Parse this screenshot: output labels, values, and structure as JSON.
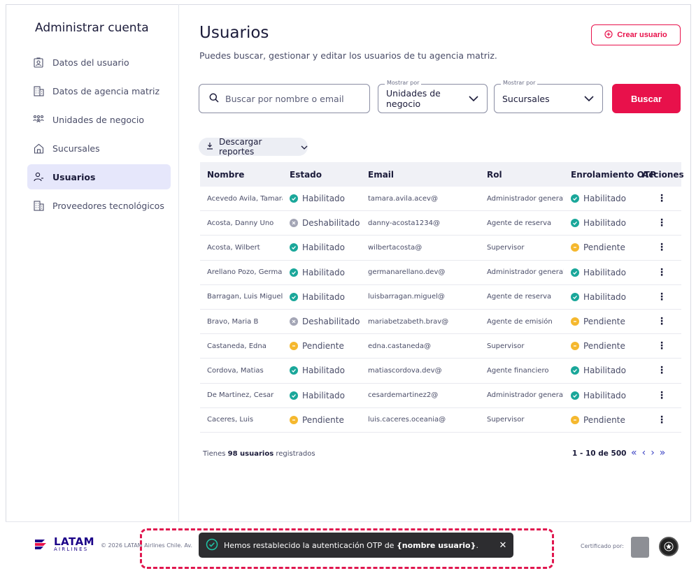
{
  "sidebar": {
    "title": "Administrar cuenta",
    "items": [
      {
        "label": "Datos del usuario",
        "icon": "user-badge-icon"
      },
      {
        "label": "Datos de agencia matriz",
        "icon": "building-icon"
      },
      {
        "label": "Unidades de negocio",
        "icon": "users-group-icon"
      },
      {
        "label": "Sucursales",
        "icon": "house-icon"
      },
      {
        "label": "Usuarios",
        "icon": "user-icon",
        "active": true
      },
      {
        "label": "Proveedores tecnológicos",
        "icon": "building-icon"
      }
    ]
  },
  "header": {
    "title": "Usuarios",
    "subtitle": "Puedes buscar, gestionar y editar los usuarios de tu agencia matriz.",
    "create_label": "Crear usuario"
  },
  "filters": {
    "search_placeholder": "Buscar por nombre o email",
    "business_unit_legend": "Mostrar por",
    "business_unit_value": "Unidades de negocio",
    "branch_legend": "Mostrar por",
    "branch_value": "Sucursales",
    "search_button": "Buscar"
  },
  "download_label": "Descargar reportes",
  "table": {
    "headers": [
      "Nombre",
      "Estado",
      "Email",
      "Rol",
      "Enrolamiento OTP",
      "Acciones"
    ],
    "rows": [
      {
        "name": "Acevedo Avila, Tamara",
        "status": "Habilitado",
        "email": "tamara.avila.acev@",
        "role": "Administrador general",
        "otp": "Habilitado"
      },
      {
        "name": "Acosta, Danny Uno",
        "status": "Deshabilitado",
        "email": "danny-acosta1234@",
        "role": "Agente de reserva",
        "otp": "Habilitado"
      },
      {
        "name": "Acosta, Wilbert",
        "status": "Habilitado",
        "email": "wilbertacosta@",
        "role": "Supervisor",
        "otp": "Pendiente"
      },
      {
        "name": "Arellano Pozo, German",
        "status": "Habilitado",
        "email": "germanarellano.dev@",
        "role": "Administrador general",
        "otp": "Habilitado"
      },
      {
        "name": "Barragan, Luis Miguel",
        "status": "Habilitado",
        "email": "luisbarragan.miguel@",
        "role": "Agente de reserva",
        "otp": "Habilitado"
      },
      {
        "name": "Bravo, Maria B",
        "status": "Deshabilitado",
        "email": "mariabetzabeth.brav@",
        "role": "Agente de emisión",
        "otp": "Pendiente"
      },
      {
        "name": "Castaneda, Edna",
        "status": "Pendiente",
        "email": "edna.castaneda@",
        "role": "Supervisor",
        "otp": "Pendiente"
      },
      {
        "name": "Cordova, Matias",
        "status": "Habilitado",
        "email": "matiascordova.dev@",
        "role": "Agente financiero",
        "otp": "Habilitado"
      },
      {
        "name": "De Martinez, Cesar",
        "status": "Habilitado",
        "email": "cesardemartinez2@",
        "role": "Administrador general",
        "otp": "Habilitado"
      },
      {
        "name": "Caceres, Luis",
        "status": "Pendiente",
        "email": "luis.caceres.oceania@",
        "role": "Supervisor",
        "otp": "Pendiente"
      }
    ],
    "action_icon": "⋮"
  },
  "footer": {
    "count_prefix": "Tienes ",
    "count_bold": "98 usuarios",
    "count_suffix": " registrados",
    "range": "1 - 10 de 500",
    "pager": [
      "«",
      "‹",
      "›",
      "»"
    ]
  },
  "bottom": {
    "logo_main": "LATAM",
    "logo_sub": "AIRLINES",
    "copyright": "© 2026 LATAM Airlines Chile. Av.",
    "certified": "Certificado por:"
  },
  "toast": {
    "prefix": "Hemos restablecido la autenticación OTP de ",
    "bold": "{nombre usuario}",
    "suffix": ".",
    "close": "✕"
  },
  "colors": {
    "brand": "#e8114b",
    "brand_dark": "#1b0088",
    "enabled": "#1aa79a",
    "pending": "#f5b82e",
    "disabled": "#a3a5b5"
  }
}
